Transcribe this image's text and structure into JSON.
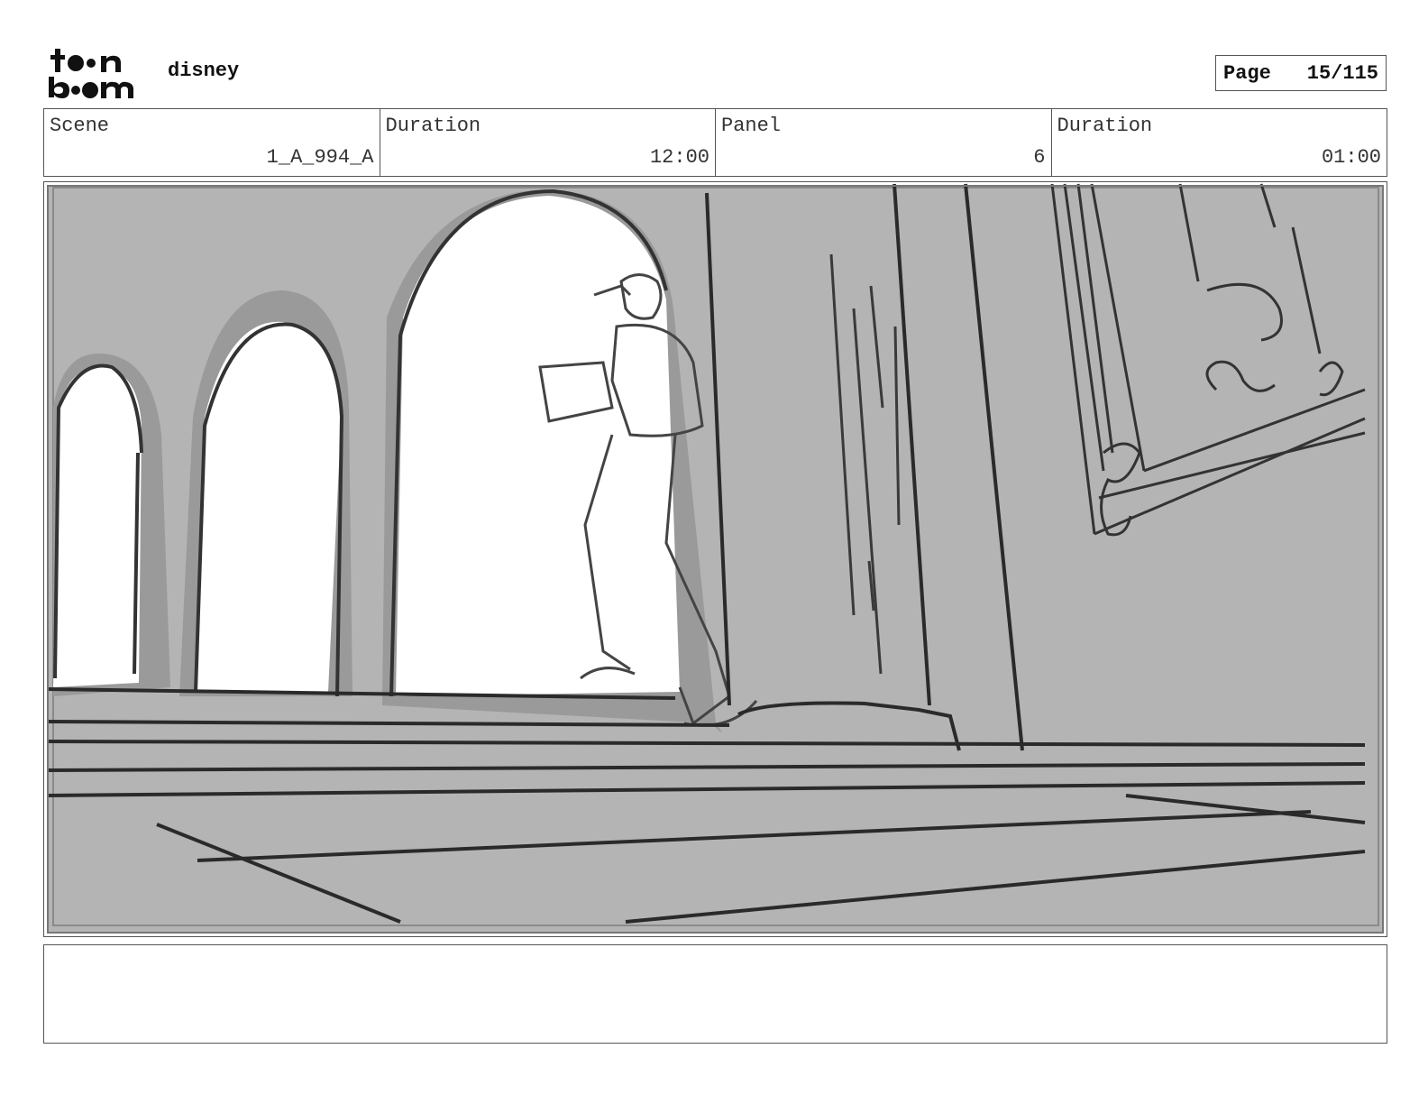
{
  "header": {
    "logo_alt": "toon boom",
    "project": "disney",
    "page_label": "Page",
    "page_number": "15/115"
  },
  "info": {
    "scene_label": "Scene",
    "scene_value": "1_A_994_A",
    "scene_duration_label": "Duration",
    "scene_duration_value": "12:00",
    "panel_label": "Panel",
    "panel_value": "6",
    "panel_duration_label": "Duration",
    "panel_duration_value": "01:00"
  },
  "notes": {
    "text": ""
  }
}
